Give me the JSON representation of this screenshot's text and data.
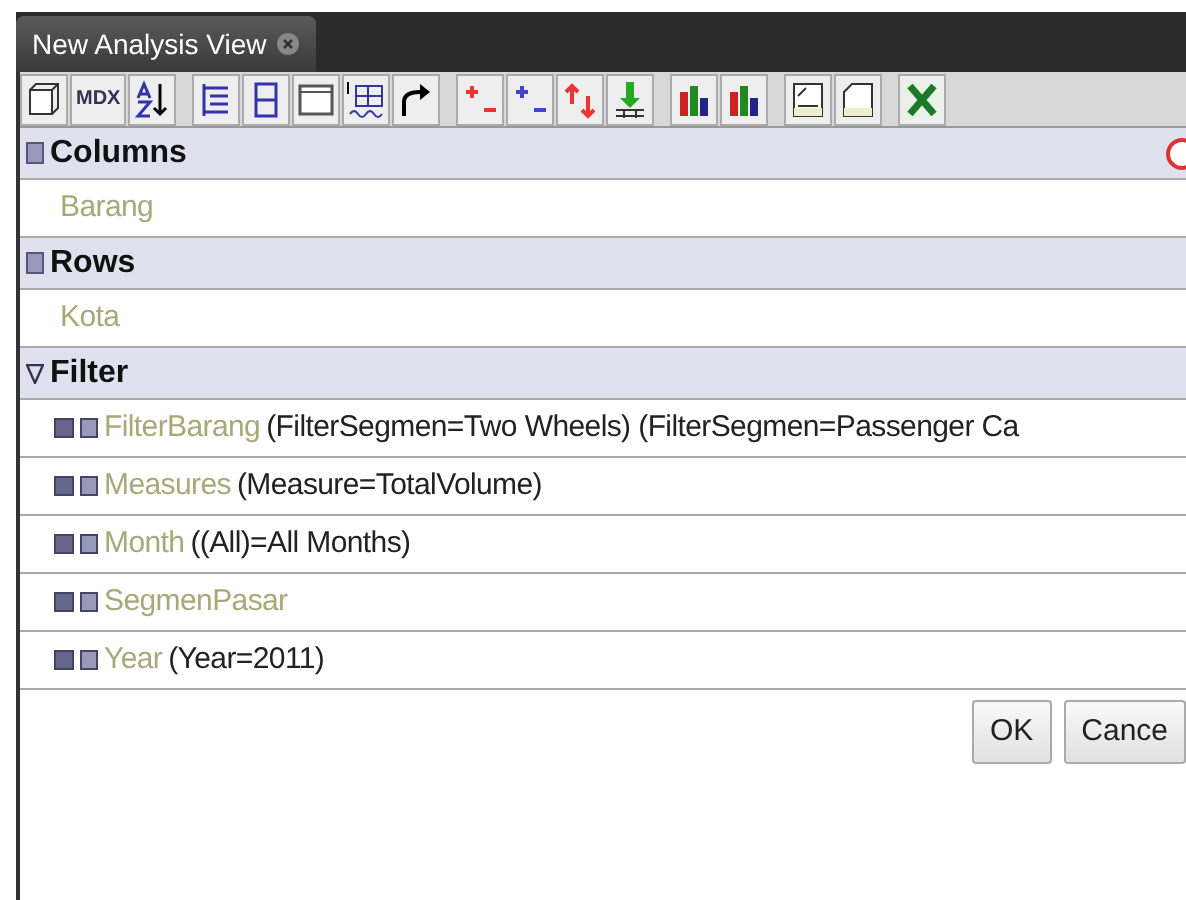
{
  "tab": {
    "title": "New Analysis View"
  },
  "toolbar": [
    {
      "kind": "cube"
    },
    {
      "kind": "text",
      "label": "MDX"
    },
    {
      "kind": "sort"
    },
    {
      "kind": "gap"
    },
    {
      "kind": "tree"
    },
    {
      "kind": "split"
    },
    {
      "kind": "panel"
    },
    {
      "kind": "grid"
    },
    {
      "kind": "swap"
    },
    {
      "kind": "gap"
    },
    {
      "kind": "plus-red"
    },
    {
      "kind": "plus-blue"
    },
    {
      "kind": "arrows"
    },
    {
      "kind": "drill"
    },
    {
      "kind": "gap"
    },
    {
      "kind": "chart"
    },
    {
      "kind": "chart"
    },
    {
      "kind": "gap"
    },
    {
      "kind": "print"
    },
    {
      "kind": "page"
    },
    {
      "kind": "gap"
    },
    {
      "kind": "excel"
    }
  ],
  "sections": [
    {
      "title": "Columns",
      "kind": "bars",
      "alert": true,
      "items": [
        {
          "name": "Barang"
        }
      ]
    },
    {
      "title": "Rows",
      "kind": "bars",
      "alert": false,
      "items": [
        {
          "name": "Kota"
        }
      ]
    },
    {
      "title": "Filter",
      "kind": "funnel",
      "alert": false,
      "items": [
        {
          "name": "FilterBarang",
          "detail": "(FilterSegmen=Two Wheels) (FilterSegmen=Passenger Ca"
        },
        {
          "name": "Measures",
          "detail": "(Measure=TotalVolume)"
        },
        {
          "name": "Month",
          "detail": "((All)=All Months)"
        },
        {
          "name": "SegmenPasar"
        },
        {
          "name": "Year",
          "detail": "(Year=2011)"
        }
      ]
    }
  ],
  "buttons": [
    "OK",
    "Cance"
  ]
}
